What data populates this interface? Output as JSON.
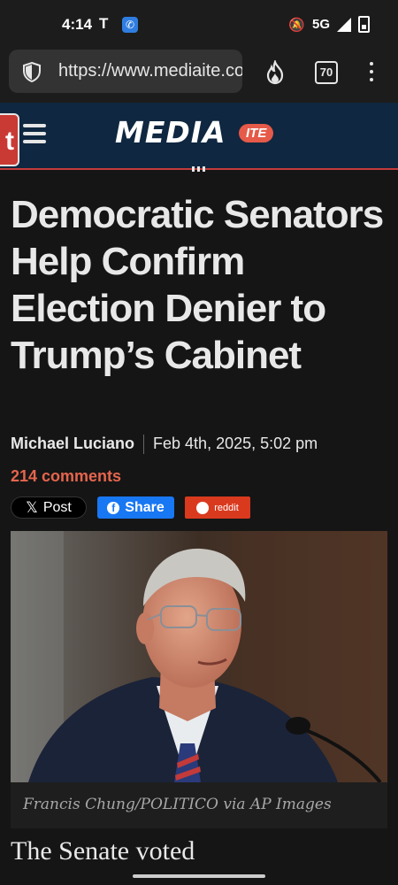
{
  "status_bar": {
    "time": "4:14",
    "carrier_icon": "T",
    "network": "5G"
  },
  "browser": {
    "url": "https://www.mediaite.com",
    "tab_count": "70"
  },
  "site": {
    "logo_main": "MEDIA",
    "logo_badge": "ITE",
    "tip_label": "t"
  },
  "article": {
    "headline": "Democratic Senators Help Confirm Election Denier to Trump’s Cabinet",
    "author": "Michael Luciano",
    "date": "Feb 4th, 2025, 5:02 pm",
    "comments": "214 comments",
    "share": {
      "x_label": "Post",
      "facebook_label": "Share",
      "reddit_label": "reddit"
    },
    "photo_caption": "Francis Chung/POLITICO via AP Images",
    "body_start": "The Senate voted"
  },
  "colors": {
    "accent": "#e5654d",
    "header_bg": "#0f2740",
    "facebook": "#1877f2",
    "reddit": "#d93a1e"
  }
}
